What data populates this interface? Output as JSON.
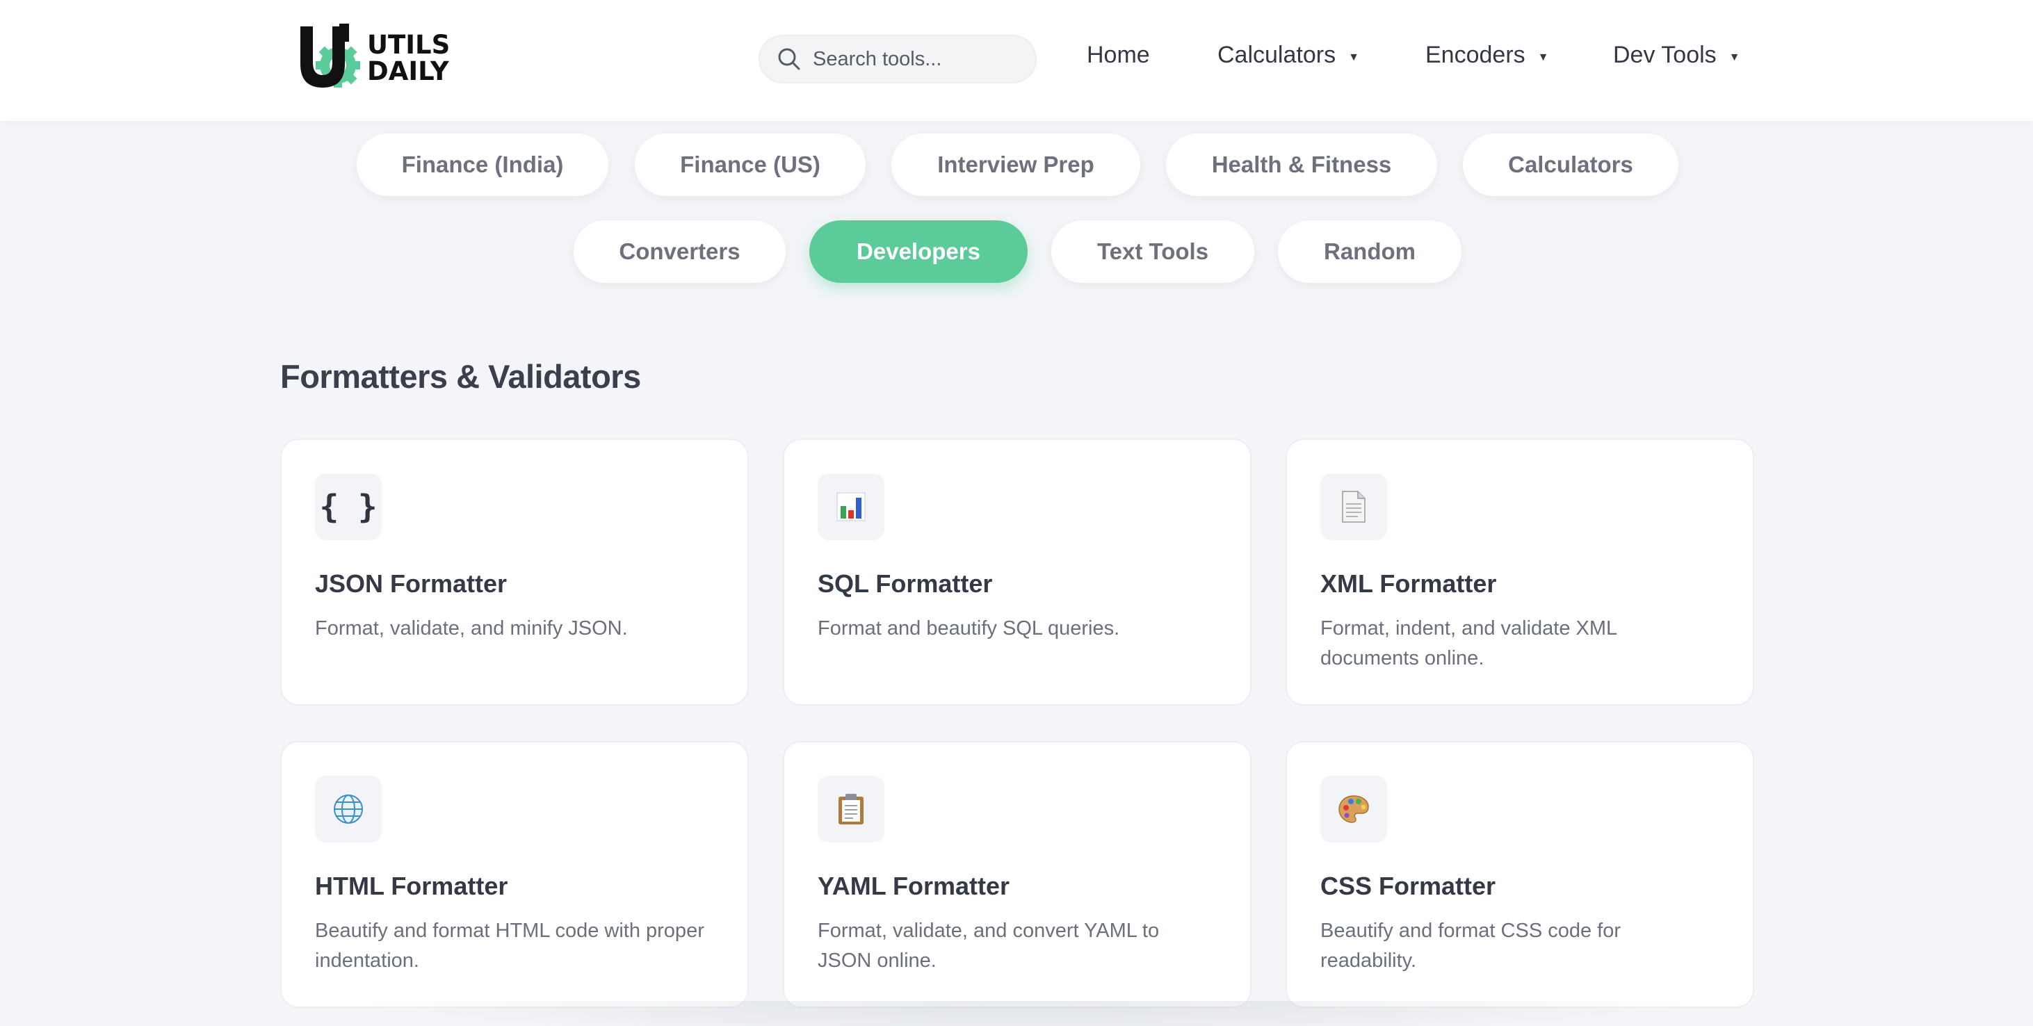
{
  "brand": {
    "line1": "UTILS",
    "line2": "DAILY",
    "accent": "#5ccb9a"
  },
  "search": {
    "placeholder": "Search tools...",
    "icon": "search-icon"
  },
  "nav": {
    "home": "Home",
    "calculators": "Calculators",
    "encoders": "Encoders",
    "dev_tools": "Dev Tools",
    "caret": "▼"
  },
  "categories": [
    {
      "label": "Finance (India)",
      "active": false
    },
    {
      "label": "Finance (US)",
      "active": false
    },
    {
      "label": "Interview Prep",
      "active": false
    },
    {
      "label": "Health & Fitness",
      "active": false
    },
    {
      "label": "Calculators",
      "active": false
    },
    {
      "label": "Converters",
      "active": false
    },
    {
      "label": "Developers",
      "active": true
    },
    {
      "label": "Text Tools",
      "active": false
    },
    {
      "label": "Random",
      "active": false
    }
  ],
  "section": {
    "title": "Formatters & Validators"
  },
  "tools": [
    {
      "title": "JSON Formatter",
      "desc": "Format, validate, and minify JSON.",
      "icon": "braces-icon",
      "glyph": "{ }"
    },
    {
      "title": "SQL Formatter",
      "desc": "Format and beautify SQL queries.",
      "icon": "bar-chart-icon"
    },
    {
      "title": "XML Formatter",
      "desc": "Format, indent, and validate XML documents online.",
      "icon": "document-icon"
    },
    {
      "title": "HTML Formatter",
      "desc": "Beautify and format HTML code with proper indentation.",
      "icon": "globe-icon"
    },
    {
      "title": "YAML Formatter",
      "desc": "Format, validate, and convert YAML to JSON online.",
      "icon": "clipboard-icon"
    },
    {
      "title": "CSS Formatter",
      "desc": "Beautify and format CSS code for readability.",
      "icon": "palette-icon"
    }
  ]
}
